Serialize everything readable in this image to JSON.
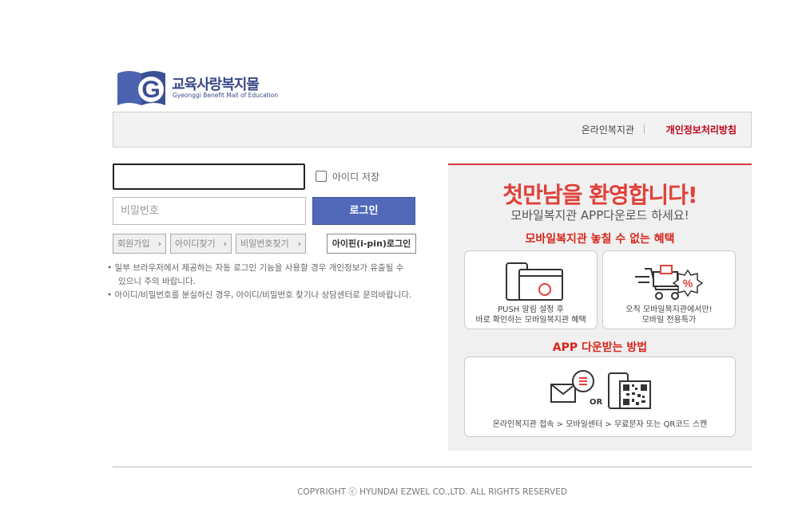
{
  "logo": {
    "title": "교육사랑복지몰",
    "subtitle": "Gyeonggi Benefit Mall of Education",
    "letter": "G"
  },
  "topbar": {
    "link_online": "온라인복지관",
    "link_privacy": "개인정보처리방침"
  },
  "login": {
    "id_value": "",
    "pw_placeholder": "비밀번호",
    "save_id_label": "아이디 저장",
    "login_button": "로그인",
    "join_button": "회원가입",
    "find_id_button": "아이디찾기",
    "find_pw_button": "비밀번호찾기",
    "ipin_button": "아이핀(i-pin)로그인",
    "notes": [
      "• 일부 브라우저에서 제공하는 자동 로그인 기능을 사용할 경우 개인정보가 유출될 수",
      "있으니 주의 바랍니다.",
      "• 아이디/비밀번호를 분실하신 경우, 아이디/비밀번호 찾기나 상담센터로 문의바랍니다."
    ]
  },
  "promo": {
    "title": "첫만남을 환영합니다!",
    "subtitle": "모바일복지관 APP다운로드 하세요!",
    "benefit_heading": "모바일복지관 놓칠 수 없는 혜택",
    "card1_line1": "PUSH 알림 설정 후",
    "card1_line2": "바로 확인하는 모바일복지관 혜택",
    "card2_line1": "오직 모바일복지관에서만!",
    "card2_line2": "모바일 전용특가",
    "download_heading": "APP 다운받는 방법",
    "or_label": "OR",
    "download_steps": "온라인복지관 접속 > 모바일센터 > 무료문자 또는 QR코드 스캔",
    "accent_color": "#e0413a"
  },
  "footer": {
    "copyright": "COPYRIGHT ⓒ HYUNDAI EZWEL CO.,LTD. ALL RIGHTS RESERVED"
  }
}
